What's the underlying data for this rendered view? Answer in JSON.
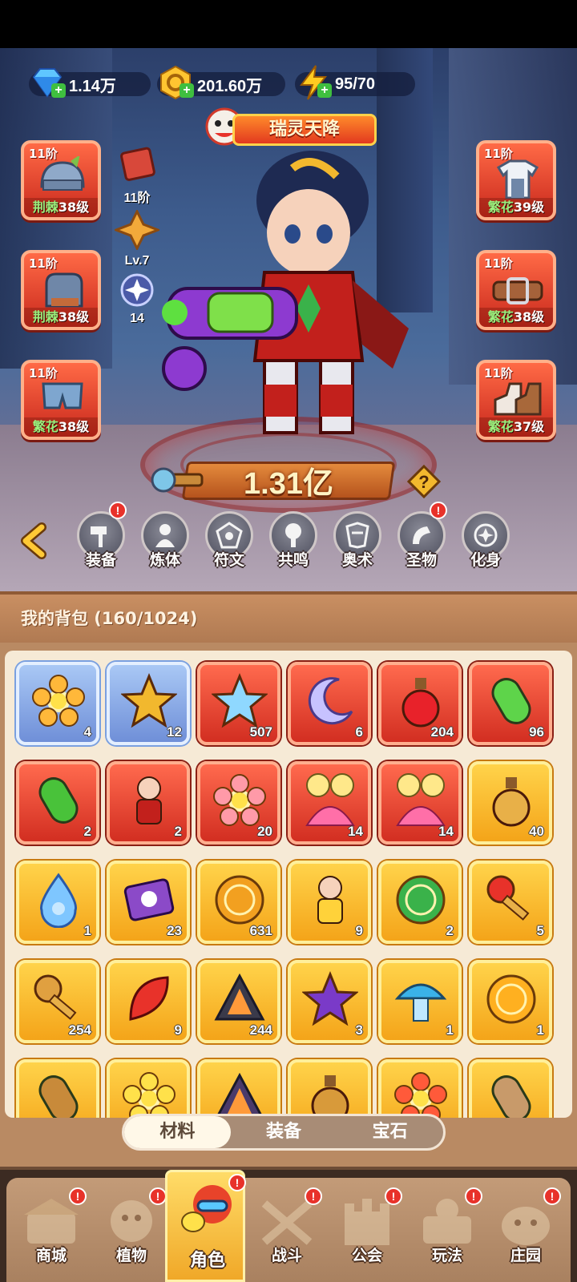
{
  "resources": {
    "diamonds": "1.14万",
    "gold": "201.60万",
    "energy": "95/70"
  },
  "event_banner": {
    "title": "瑞灵天降"
  },
  "equipment": {
    "left": [
      {
        "tier": "11阶",
        "set": "荆棘",
        "level": "38级"
      },
      {
        "tier": "11阶",
        "set": "荆棘",
        "level": "38级"
      },
      {
        "tier": "11阶",
        "set": "繁花",
        "level": "38级"
      }
    ],
    "right": [
      {
        "tier": "11阶",
        "set": "繁花",
        "level": "39级"
      },
      {
        "tier": "11阶",
        "set": "繁花",
        "level": "38级"
      },
      {
        "tier": "11阶",
        "set": "繁花",
        "level": "37级"
      }
    ]
  },
  "stats": {
    "relic_tier": "11阶",
    "star_level": "Lv.7",
    "spirit_count": "14"
  },
  "power": "1.31亿",
  "nav": [
    {
      "label": "装备",
      "icon": "hammer-icon",
      "alert": true
    },
    {
      "label": "炼体",
      "icon": "body-icon",
      "alert": false
    },
    {
      "label": "符文",
      "icon": "rune-icon",
      "alert": false
    },
    {
      "label": "共鸣",
      "icon": "tree-icon",
      "alert": false
    },
    {
      "label": "奥术",
      "icon": "arcane-icon",
      "alert": false
    },
    {
      "label": "圣物",
      "icon": "relic-icon",
      "alert": true
    },
    {
      "label": "化身",
      "icon": "avatar-icon",
      "alert": false
    }
  ],
  "bag": {
    "title": "我的背包 (160/1024)",
    "items": [
      {
        "icon": "duck-flower-icon",
        "count": "4",
        "quality": "blue"
      },
      {
        "icon": "star-icon",
        "count": "12",
        "quality": "blue"
      },
      {
        "icon": "crystal-star-icon",
        "count": "507",
        "quality": "red"
      },
      {
        "icon": "moon-gem-icon",
        "count": "6",
        "quality": "red"
      },
      {
        "icon": "red-potion-icon",
        "count": "204",
        "quality": "red"
      },
      {
        "icon": "green-capsule-icon",
        "count": "96",
        "quality": "red"
      },
      {
        "icon": "green-pill-icon",
        "count": "2",
        "quality": "red"
      },
      {
        "icon": "hero-figure-icon",
        "count": "2",
        "quality": "red"
      },
      {
        "icon": "flower-gem-icon",
        "count": "20",
        "quality": "red"
      },
      {
        "icon": "lotus-pair-icon",
        "count": "14",
        "quality": "red"
      },
      {
        "icon": "lotus-pair-icon",
        "count": "14",
        "quality": "red"
      },
      {
        "icon": "gold-bottle-icon",
        "count": "40",
        "quality": "gold"
      },
      {
        "icon": "water-drop-icon",
        "count": "1",
        "quality": "gold"
      },
      {
        "icon": "skull-scroll-icon",
        "count": "23",
        "quality": "gold"
      },
      {
        "icon": "duck-coin-icon",
        "count": "631",
        "quality": "gold"
      },
      {
        "icon": "duck-jetski-icon",
        "count": "9",
        "quality": "gold"
      },
      {
        "icon": "compass-icon",
        "count": "2",
        "quality": "gold"
      },
      {
        "icon": "ruby-key-icon",
        "count": "5",
        "quality": "gold"
      },
      {
        "icon": "gold-key-icon",
        "count": "254",
        "quality": "gold"
      },
      {
        "icon": "fire-leaf-icon",
        "count": "9",
        "quality": "gold"
      },
      {
        "icon": "pyramid-icon",
        "count": "244",
        "quality": "gold"
      },
      {
        "icon": "star-amulet-icon",
        "count": "3",
        "quality": "gold"
      },
      {
        "icon": "mushroom-icon",
        "count": "1",
        "quality": "gold"
      },
      {
        "icon": "gold-orb-icon",
        "count": "1",
        "quality": "gold"
      },
      {
        "icon": "gold-chest-icon",
        "count": "",
        "quality": "gold"
      },
      {
        "icon": "gold-flower-icon",
        "count": "",
        "quality": "gold"
      },
      {
        "icon": "rune-stone-icon",
        "count": "",
        "quality": "gold"
      },
      {
        "icon": "gold-potion-icon",
        "count": "",
        "quality": "gold"
      },
      {
        "icon": "red-flower-icon",
        "count": "",
        "quality": "gold"
      },
      {
        "icon": "pot-icon",
        "count": "",
        "quality": "gold"
      }
    ]
  },
  "tabs": [
    {
      "label": "材料",
      "active": true
    },
    {
      "label": "装备",
      "active": false
    },
    {
      "label": "宝石",
      "active": false
    }
  ],
  "bottom_nav": [
    {
      "label": "商城",
      "alert": true,
      "active": false
    },
    {
      "label": "植物",
      "alert": true,
      "active": false
    },
    {
      "label": "角色",
      "alert": true,
      "active": true
    },
    {
      "label": "战斗",
      "alert": true,
      "active": false
    },
    {
      "label": "公会",
      "alert": true,
      "active": false
    },
    {
      "label": "玩法",
      "alert": true,
      "active": false
    },
    {
      "label": "庄园",
      "alert": true,
      "active": false
    }
  ]
}
